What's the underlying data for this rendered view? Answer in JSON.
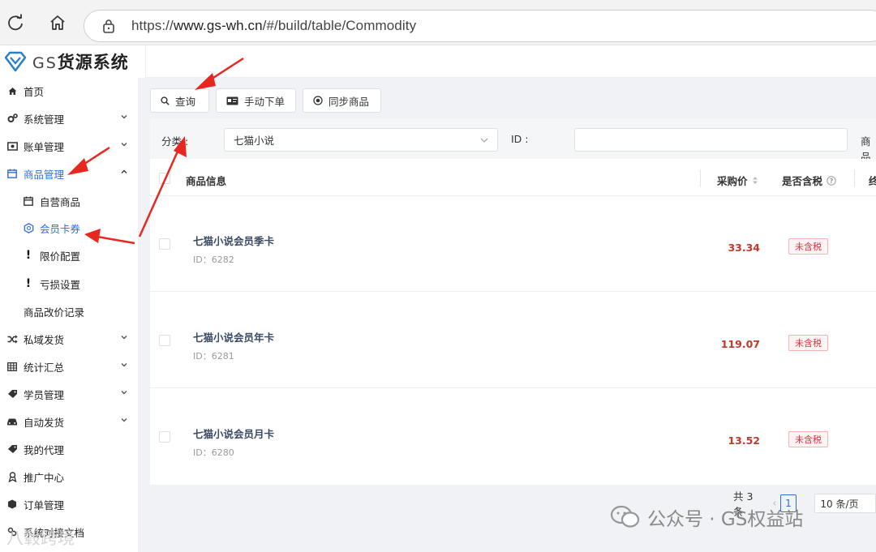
{
  "browser": {
    "url_prefix": "https://",
    "url_host": "www.gs-wh.cn",
    "url_path": "/#/build/table/Commodity"
  },
  "app": {
    "logo_prefix": "GS",
    "logo_title": "货源系统"
  },
  "sidebar": {
    "items": [
      {
        "label": "首页",
        "icon": "home-icon"
      },
      {
        "label": "系统管理",
        "icon": "gears-icon"
      },
      {
        "label": "账单管理",
        "icon": "bill-icon"
      },
      {
        "label": "商品管理",
        "icon": "calendar-icon"
      },
      {
        "label": "自营商品",
        "icon": "calendar-icon"
      },
      {
        "label": "会员卡券",
        "icon": "hexagon-icon"
      },
      {
        "label": "限价配置",
        "icon": "exclamation-icon"
      },
      {
        "label": "亏损设置",
        "icon": "exclamation-icon"
      },
      {
        "label": "商品改价记录",
        "icon": ""
      },
      {
        "label": "私域发货",
        "icon": "shuffle-icon"
      },
      {
        "label": "统计汇总",
        "icon": "table-icon"
      },
      {
        "label": "学员管理",
        "icon": "ticket-icon"
      },
      {
        "label": "自动发货",
        "icon": "car-icon"
      },
      {
        "label": "我的代理",
        "icon": "ticket-icon"
      },
      {
        "label": "推广中心",
        "icon": "ribbon-icon"
      },
      {
        "label": "订单管理",
        "icon": "cube-icon"
      },
      {
        "label": "系统对接文档",
        "icon": "link-icon"
      }
    ]
  },
  "toolbar": {
    "query_label": "查询",
    "manual_order_label": "手动下单",
    "sync_label": "同步商品"
  },
  "filter": {
    "category_label": "分类 :",
    "category_value": "七猫小说",
    "id_label": "ID :",
    "id_value": "",
    "product_label": "商品"
  },
  "table": {
    "headers": {
      "info": "商品信息",
      "price": "采购价",
      "tax": "是否含税",
      "next": "终"
    },
    "rows": [
      {
        "name": "七猫小说会员季卡",
        "id": "ID：6282",
        "price": "33.34",
        "tax": "未含税"
      },
      {
        "name": "七猫小说会员年卡",
        "id": "ID：6281",
        "price": "119.07",
        "tax": "未含税"
      },
      {
        "name": "七猫小说会员月卡",
        "id": "ID：6280",
        "price": "13.52",
        "tax": "未含税"
      }
    ]
  },
  "pagination": {
    "total": "共 3 条",
    "current_page": "1",
    "page_size": "10 条/页"
  },
  "watermark": {
    "right_text": "公众号 · GS权益站",
    "left_text": "八毂跨境"
  },
  "colors": {
    "accent": "#2f6ed8",
    "price": "#c0392b",
    "annotation": "#e8281e"
  }
}
